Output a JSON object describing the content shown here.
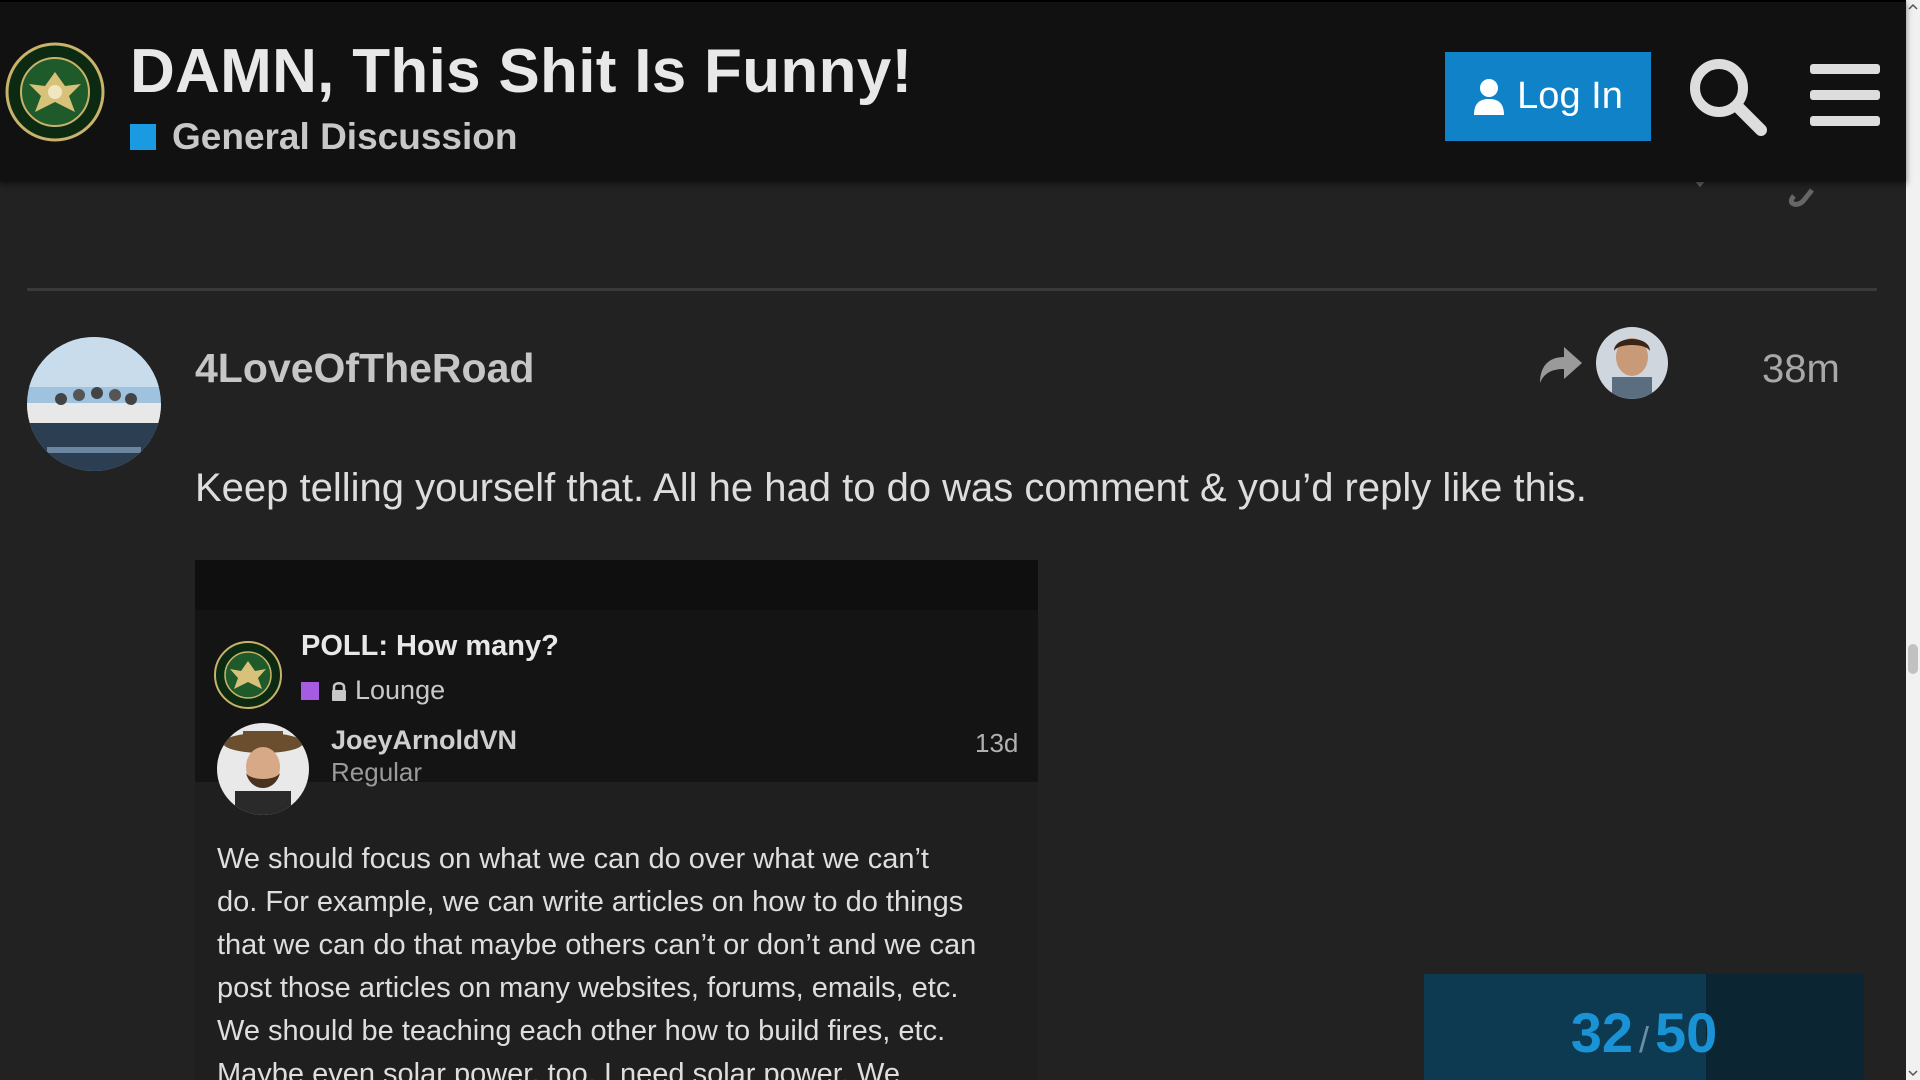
{
  "header": {
    "topic_title": "DAMN, This Shit Is Funny!",
    "category": {
      "name": "General Discussion",
      "color": "#1a9ae0"
    },
    "login_label": "Log In",
    "logo_icon": "infowars-army-seal-icon",
    "search_icon": "search-icon",
    "menu_icon": "hamburger-menu-icon"
  },
  "post": {
    "username": "4LoveOfTheRoad",
    "date": "38m",
    "reply_icon": "reply-arrow-icon",
    "body": "Keep telling yourself that. All he had to do was comment & you’d reply like this."
  },
  "embed": {
    "title": "POLL: How many?",
    "category": {
      "name": "Lounge",
      "color": "#a55ce0",
      "locked": true
    },
    "author": "JoeyArnoldVN",
    "role": "Regular",
    "time": "13d",
    "lines": [
      "We should focus on what we can do over what we can’t",
      "do. For example, we can write articles on how to do things",
      "that we can do that maybe others can’t or don’t and we can",
      "post those articles on many websites, forums, emails, etc.",
      "We should be teaching each other how to build fires, etc.",
      "Maybe even solar power, too. I need solar power. We"
    ]
  },
  "progress": {
    "current": "32",
    "separator": "/",
    "total": "50",
    "fill_fraction": 0.64
  },
  "colors": {
    "accent": "#1083c8",
    "background": "#222222",
    "header": "#111111"
  }
}
